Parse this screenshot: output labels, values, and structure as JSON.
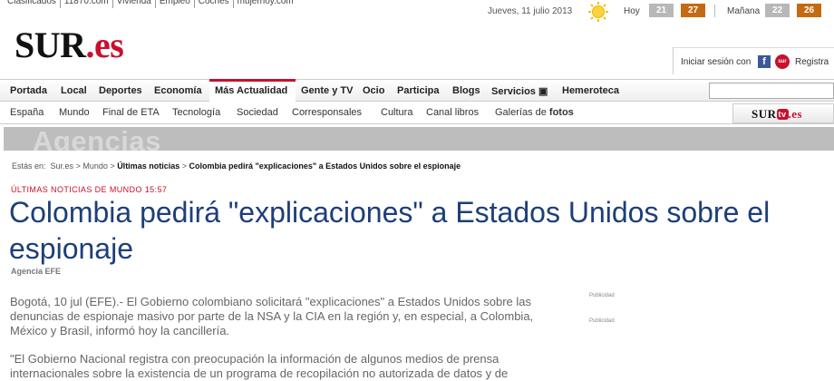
{
  "top_links": [
    "Clasificados",
    "11870.com",
    "Vivienda",
    "Empleo",
    "Coches",
    "mujerhoy.com"
  ],
  "date": "Jueves, 11 julio 2013",
  "weather": {
    "today_label": "Hoy",
    "today_min": "21",
    "today_max": "27",
    "tomorrow_label": "Mañana",
    "tomorrow_min": "22",
    "tomorrow_max": "26",
    "icon": "sun-icon",
    "min_color": "#b8b8b8",
    "max_color": "#c46a12"
  },
  "logo": {
    "main": "SUR",
    "suffix": ".es"
  },
  "login": {
    "label": "Iniciar sesión con",
    "register": "Registra",
    "sur_badge": "sur"
  },
  "nav_main": [
    "Portada",
    "Local",
    "Deportes",
    "Economía",
    "Más Actualidad",
    "Gente y TV",
    "Ocio",
    "Participa",
    "Blogs",
    "Servicios",
    "Hemeroteca"
  ],
  "nav_main_active": "Más Actualidad",
  "nav_sub": [
    "España",
    "Mundo",
    "Final de ETA",
    "Tecnología",
    "Sociedad",
    "Corresponsales",
    "Cultura",
    "Canal libros"
  ],
  "nav_sub_gallery": {
    "prefix": "Galerías de ",
    "bold": "fotos"
  },
  "surtv": {
    "sur": "SUR",
    "tv": "tv",
    "es": ".es"
  },
  "section_banner": "Agencias",
  "breadcrumb": {
    "prefix": "Estás en:",
    "items": [
      "Sur.es",
      "Mundo",
      "Últimas noticias",
      "Colombia pedirá \"explicaciones\" a Estados Unidos sobre el espionaje"
    ]
  },
  "article": {
    "kicker": "ÚLTIMAS NOTICIAS DE MUNDO 15:57",
    "title": "Colombia pedirá \"explicaciones\" a Estados Unidos sobre el espionaje",
    "byline": "Agencia EFE",
    "paragraph1": "Bogotá, 10 jul (EFE).- El Gobierno colombiano solicitará \"explicaciones\" a Estados Unidos sobre las denuncias de espionaje masivo por parte de la NSA y la CIA en la región y, en especial, a Colombia, México y Brasil, informó hoy la cancillería.",
    "paragraph2": "\"El Gobierno Nacional registra con preocupación la información de algunos medios de prensa internacionales sobre la existencia de un programa de recopilación no autorizada de datos y de"
  },
  "ads": [
    "Publicidad",
    "Publicidad"
  ],
  "colors": {
    "brand_red": "#c8102e",
    "headline_blue": "#1d3f78"
  }
}
